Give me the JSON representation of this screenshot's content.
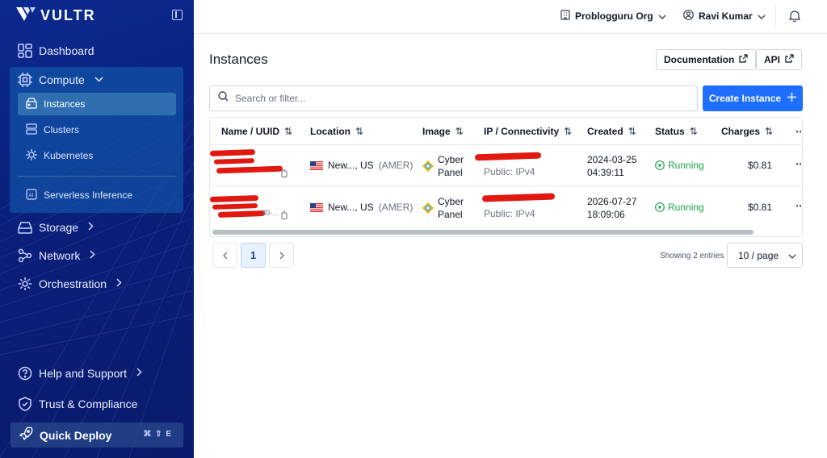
{
  "sidebar": {
    "brand": "VULTR",
    "items": {
      "dashboard": "Dashboard",
      "compute": "Compute",
      "instances": "Instances",
      "clusters": "Clusters",
      "kubernetes": "Kubernetes",
      "serverless": "Serverless Inference",
      "storage": "Storage",
      "network": "Network",
      "orchestration": "Orchestration",
      "help": "Help and Support",
      "trust": "Trust & Compliance",
      "quick_deploy": "Quick Deploy",
      "quick_deploy_shortcut": "⌘ ⇧ E"
    }
  },
  "topbar": {
    "org": "Problogguru Org",
    "user": "Ravi Kumar"
  },
  "main": {
    "title": "Instances",
    "documentation": "Documentation",
    "api": "API",
    "search_placeholder": "Search or filter...",
    "create_button": "Create Instance"
  },
  "table": {
    "headers": [
      "Name / UUID",
      "Location",
      "Image",
      "IP / Connectivity",
      "Created",
      "Status",
      "Charges"
    ],
    "rows": [
      {
        "location": "New..., US",
        "region": "(AMER)",
        "image_line1": "Cyber",
        "image_line2": "Panel",
        "ip_public": "Public: IPv4",
        "created_date": "2024-03-25",
        "created_time": "04:39:11",
        "status": "Running",
        "charges": "$0.81"
      },
      {
        "uuid_fragment": "80-...",
        "location": "New..., US",
        "region": "(AMER)",
        "image_line1": "Cyber",
        "image_line2": "Panel",
        "ip_public": "Public: IPv4",
        "created_date": "2026-07-27",
        "created_time": "18:09:06",
        "status": "Running",
        "charges": "$0.81"
      }
    ]
  },
  "pagination": {
    "current_page": "1",
    "showing": "Showing 2 entries",
    "page_size": "10 / page"
  },
  "colors": {
    "sidebar_bg": "#0a1f7a",
    "primary": "#1e6fff",
    "running": "#16a34a"
  }
}
